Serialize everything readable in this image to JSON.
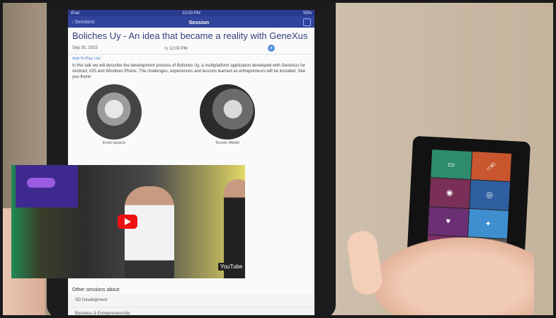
{
  "status": {
    "left": "iPad",
    "time": "10:03 PM",
    "battery": "55%"
  },
  "nav": {
    "back_label": "Sessions",
    "title": "Session"
  },
  "session": {
    "title": "Boliches Uy - An idea that became a reality with GeneXus",
    "date": "Sep 30, 2015",
    "time": "12:00 PM",
    "add_to_playlist": "Add To Play List",
    "description": "In this talk we will describe the development process of Boliches Uy, a multiplatform application developed with GeneXus for Android, iOS and Windows Phone. The challenges, experiences and lessons learned as entrepreneurs will be included. See you there!"
  },
  "speakers": [
    {
      "name": "Ernie Ignacio"
    },
    {
      "name": "Torcelo Martin"
    }
  ],
  "video": {
    "logo": "YouTube"
  },
  "other_sessions": {
    "heading": "Other sessions about:",
    "items": [
      "SD Development",
      "Business & Entrepreneurship"
    ]
  },
  "icons": [
    "share-icon",
    "favorite-icon",
    "play-icon",
    "chat-icon",
    "mic-icon",
    "eye-icon",
    "target-icon",
    "heart-icon",
    "twitter-icon",
    "food-icon"
  ]
}
